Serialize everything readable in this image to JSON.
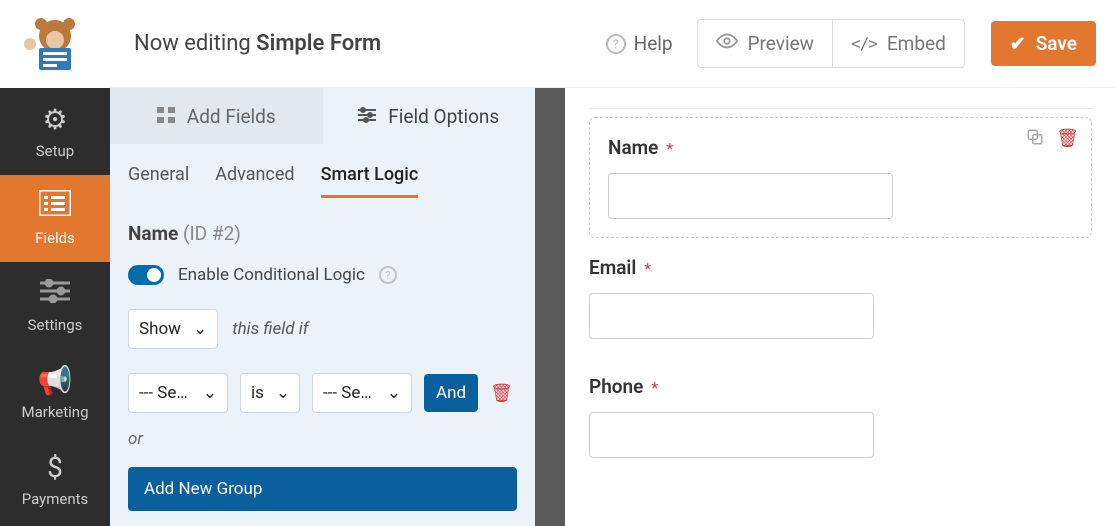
{
  "topbar": {
    "editing_prefix": "Now editing",
    "form_name": "Simple Form",
    "help": "Help",
    "preview": "Preview",
    "embed": "Embed",
    "save": "Save"
  },
  "nav": {
    "setup": "Setup",
    "fields": "Fields",
    "settings": "Settings",
    "marketing": "Marketing",
    "payments": "Payments"
  },
  "panel": {
    "tab_add": "Add Fields",
    "tab_options": "Field Options",
    "subtabs": {
      "general": "General",
      "advanced": "Advanced",
      "smart": "Smart Logic"
    },
    "field_name": "Name",
    "field_id": "(ID #2)",
    "enable_cl": "Enable Conditional Logic",
    "action": "Show",
    "action_suffix": "this field if",
    "sel_placeholder": "--- Select Field ---",
    "op": "is",
    "val_placeholder": "--- Select Choice ---",
    "and": "And",
    "or": "or",
    "add_group": "Add New Group"
  },
  "preview": {
    "fields": [
      {
        "label": "Name",
        "required": true,
        "selected": true
      },
      {
        "label": "Email",
        "required": true,
        "selected": false
      },
      {
        "label": "Phone",
        "required": true,
        "selected": false
      }
    ]
  }
}
